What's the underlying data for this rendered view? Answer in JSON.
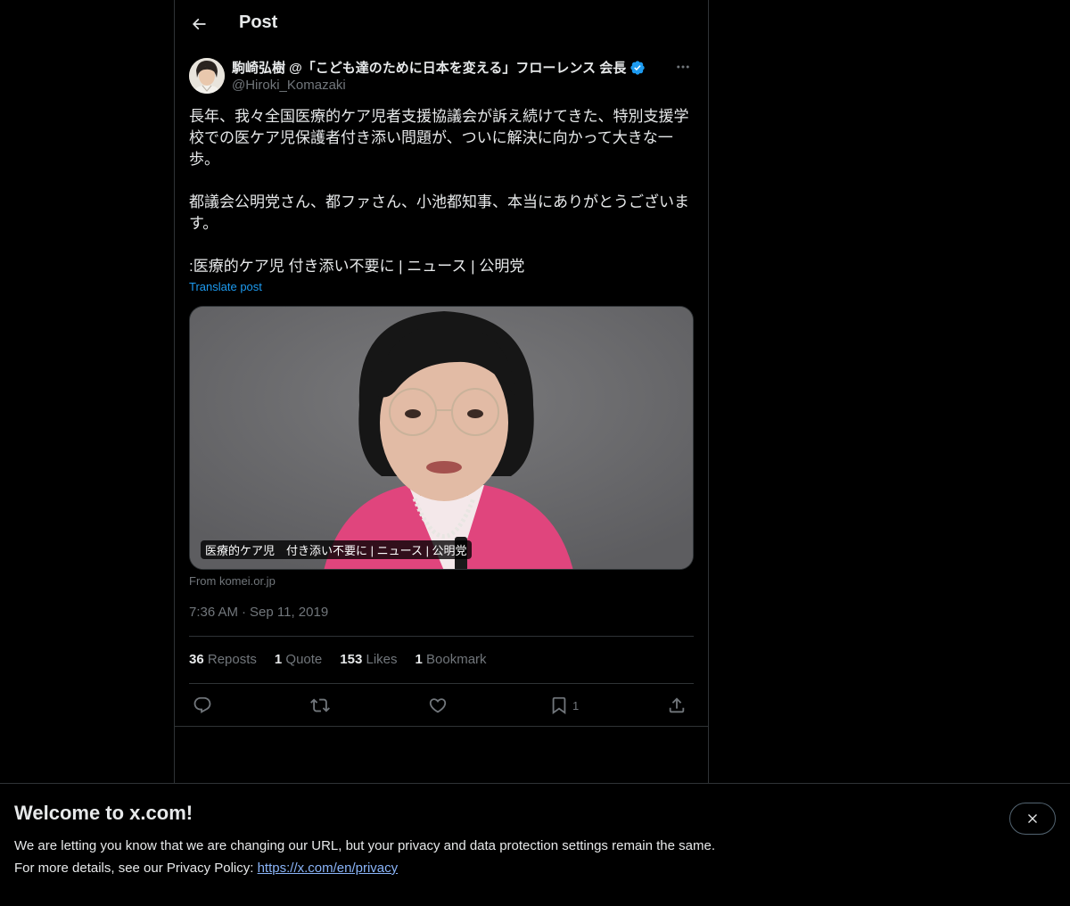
{
  "topbar": {
    "title": "Post"
  },
  "author": {
    "display_name": "駒崎弘樹 @「こども達のために日本を変える」フローレンス 会長",
    "handle": "@Hiroki_Komazaki",
    "verified": true
  },
  "post": {
    "paragraph_1": "長年、我々全国医療的ケア児者支援協議会が訴え続けてきた、特別支援学校での医ケア児保護者付き添い問題が、ついに解決に向かって大きな一歩。",
    "paragraph_2": "都議会公明党さん、都ファさん、小池都知事、本当にありがとうございます。",
    "paragraph_3": ":医療的ケア児 付き添い不要に | ニュース | 公明党",
    "translate_label": "Translate post"
  },
  "card": {
    "caption": "医療的ケア児　付き添い不要に | ニュース | 公明党",
    "source": "From komei.or.jp"
  },
  "meta": {
    "time": "7:36 AM",
    "separator": "·",
    "date": "Sep 11, 2019"
  },
  "stats": {
    "reposts": {
      "count": "36",
      "label": "Reposts"
    },
    "quotes": {
      "count": "1",
      "label": "Quote"
    },
    "likes": {
      "count": "153",
      "label": "Likes"
    },
    "bookmarks": {
      "count": "1",
      "label": "Bookmark"
    }
  },
  "actions": {
    "reply_icon": "reply-icon",
    "repost_icon": "repost-icon",
    "like_icon": "heart-icon",
    "bookmark_icon": "bookmark-icon",
    "bookmark_count": "1",
    "share_icon": "share-icon"
  },
  "banner": {
    "title": "Welcome to x.com!",
    "line_1": "We are letting you know that we are changing our URL, but your privacy and data protection settings remain the same.",
    "line_2_prefix": "For more details, see our Privacy Policy: ",
    "link": "https://x.com/en/privacy"
  },
  "colors": {
    "background": "#000000",
    "text_primary": "#e7e9ea",
    "text_secondary": "#71767b",
    "accent": "#1d9bf0",
    "border": "#2f3336"
  }
}
